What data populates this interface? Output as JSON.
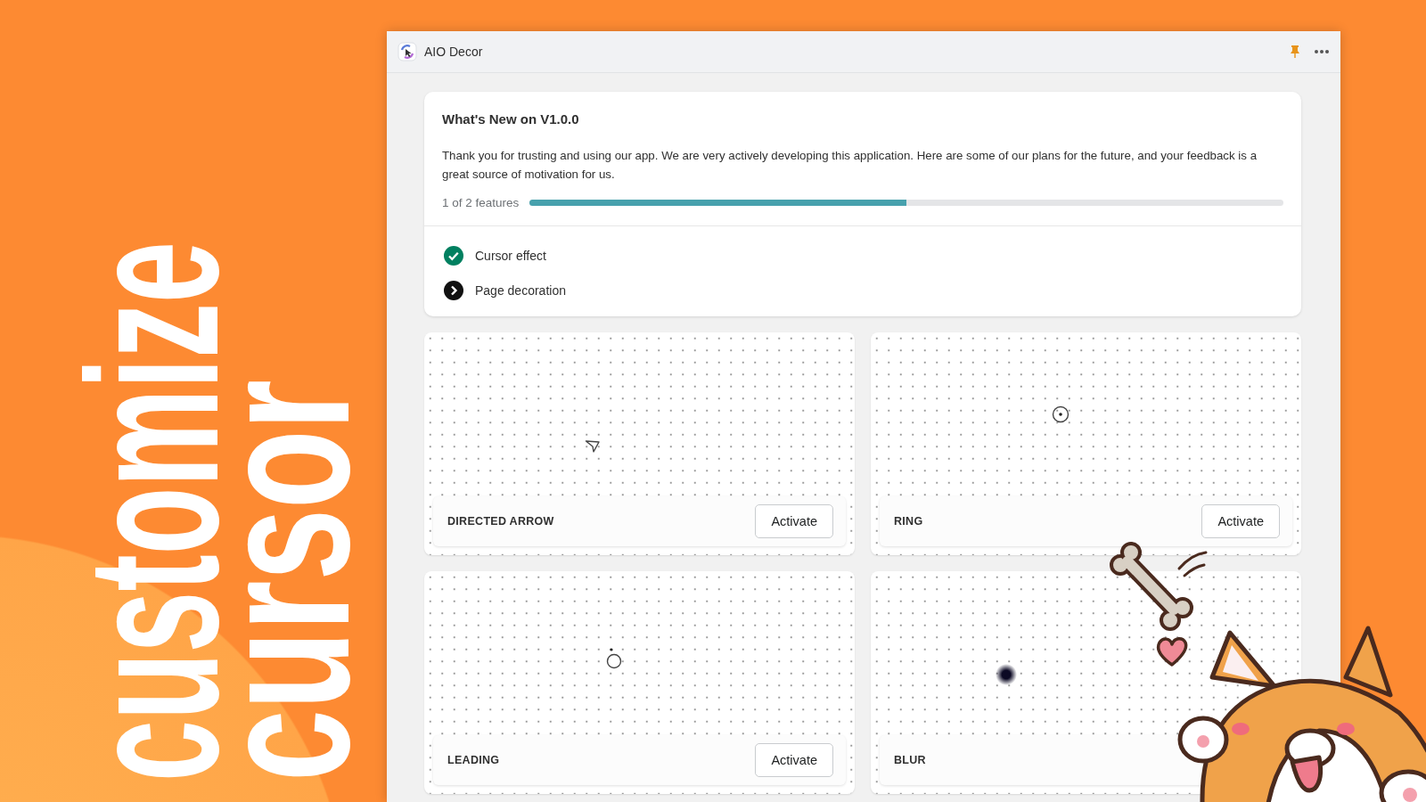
{
  "promo": {
    "lines": [
      "customize",
      "cursor"
    ]
  },
  "window": {
    "title": "AIO Decor"
  },
  "whats_new": {
    "title": "What's New on V1.0.0",
    "description": "Thank you for trusting and using our app. We are very actively developing this application. Here are some of our plans for the future, and your feedback is a great source of motivation for us.",
    "progress_label": "1 of 2 features",
    "level": 0.5,
    "features": [
      {
        "label": "Cursor effect",
        "done": true
      },
      {
        "label": "Page decoration",
        "done": false
      }
    ]
  },
  "cursors": [
    {
      "name": "DIRECTED ARROW",
      "kind": "arrow",
      "button": "Activate"
    },
    {
      "name": "RING",
      "kind": "ring",
      "button": "Activate"
    },
    {
      "name": "LEADING",
      "kind": "leading",
      "button": "Activate"
    },
    {
      "name": "BLUR",
      "kind": "blur"
    }
  ]
}
